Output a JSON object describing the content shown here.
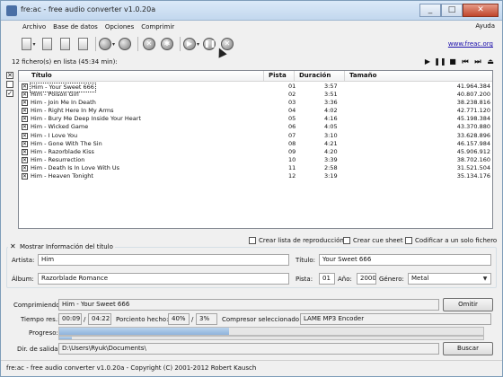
{
  "window": {
    "title": "fre:ac - free audio converter v1.0.20a",
    "controls": [
      "_",
      "□",
      "✕"
    ]
  },
  "menu": {
    "items": [
      "Archivo",
      "Base de datos",
      "Opciones",
      "Comprimir"
    ],
    "help": "Ayuda"
  },
  "toolbar": {
    "website_link": "www.freac.org"
  },
  "filelist": {
    "count_text": "12 fichero(s) en lista (45:34 min):",
    "columns": {
      "title": "Título",
      "track": "Pista",
      "duration": "Duración",
      "size": "Tamaño"
    },
    "rows": [
      {
        "title": "Him - Your Sweet 666",
        "track": "01",
        "duration": "3:57",
        "size": "41.964.384"
      },
      {
        "title": "Him - Poison Girl",
        "track": "02",
        "duration": "3:51",
        "size": "40.807.200"
      },
      {
        "title": "Him - Join Me In Death",
        "track": "03",
        "duration": "3:36",
        "size": "38.238.816"
      },
      {
        "title": "Him - Right Here In My Arms",
        "track": "04",
        "duration": "4:02",
        "size": "42.771.120"
      },
      {
        "title": "Him - Bury Me Deep Inside Your Heart",
        "track": "05",
        "duration": "4:16",
        "size": "45.198.384"
      },
      {
        "title": "Him - Wicked Game",
        "track": "06",
        "duration": "4:05",
        "size": "43.370.880"
      },
      {
        "title": "Him - I Love You",
        "track": "07",
        "duration": "3:10",
        "size": "33.628.896"
      },
      {
        "title": "Him - Gone With The Sin",
        "track": "08",
        "duration": "4:21",
        "size": "46.157.984"
      },
      {
        "title": "Him - Razorblade Kiss",
        "track": "09",
        "duration": "4:20",
        "size": "45.906.912"
      },
      {
        "title": "Him - Resurrection",
        "track": "10",
        "duration": "3:39",
        "size": "38.702.160"
      },
      {
        "title": "Him - Death Is In Love With Us",
        "track": "11",
        "duration": "2:58",
        "size": "31.521.504"
      },
      {
        "title": "Him - Heaven Tonight",
        "track": "12",
        "duration": "3:19",
        "size": "35.134.176"
      }
    ]
  },
  "options": {
    "playlist": "Crear lista de reproducción",
    "cue": "Crear cue sheet",
    "single_file": "Codificar a un solo fichero"
  },
  "info": {
    "toggle_label": "Mostrar Información del título",
    "artist_label": "Artista:",
    "artist": "Him",
    "title_label": "Título:",
    "title": "Your Sweet 666",
    "album_label": "Álbum:",
    "album": "Razorblade Romance",
    "track_label": "Pista:",
    "track": "01",
    "year_label": "Año:",
    "year": "2000",
    "genre_label": "Género:",
    "genre": "Metal"
  },
  "encode": {
    "compressing_label": "Comprimiendo:",
    "compressing": "Him - Your Sweet 666",
    "skip_button": "Omitir",
    "time_label": "Tiempo res.:",
    "time_elapsed": "00:09",
    "time_sep": "/",
    "time_total": "04:22",
    "percent_label": "Porciento hecho:",
    "percent_track": "40%",
    "percent_sep": "/",
    "percent_total": "3%",
    "encoder_label": "Compresor seleccionado:",
    "encoder": "LAME MP3 Encoder",
    "progress_label": "Progreso:",
    "progress_track": 0.4,
    "progress_total": 0.03,
    "output_label": "Dir. de salida:",
    "output_dir": "D:\\Users\\Ryuk\\Documents\\",
    "browse_button": "Buscar"
  },
  "status": {
    "text": "fre:ac - free audio converter v1.0.20a - Copyright (C) 2001-2012 Robert Kausch"
  }
}
